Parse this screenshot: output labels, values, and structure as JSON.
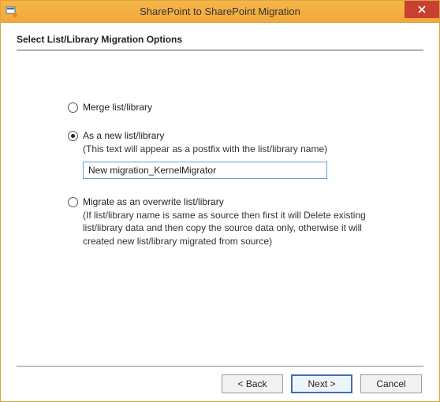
{
  "window": {
    "title": "SharePoint to SharePoint Migration"
  },
  "heading": "Select List/Library Migration Options",
  "options": {
    "merge": {
      "label": "Merge list/library",
      "checked": false
    },
    "new": {
      "label": "As a new list/library",
      "checked": true,
      "help": "(This text will appear as a postfix with the list/library name)",
      "input_value": "New migration_KernelMigrator"
    },
    "overwrite": {
      "label": "Migrate as an overwrite list/library",
      "checked": false,
      "help": "(If list/library name is same as source then first it will Delete existing list/library data and then copy the source data only, otherwise it will created new list/library migrated from source)"
    }
  },
  "buttons": {
    "back": "< Back",
    "next": "Next >",
    "cancel": "Cancel"
  }
}
